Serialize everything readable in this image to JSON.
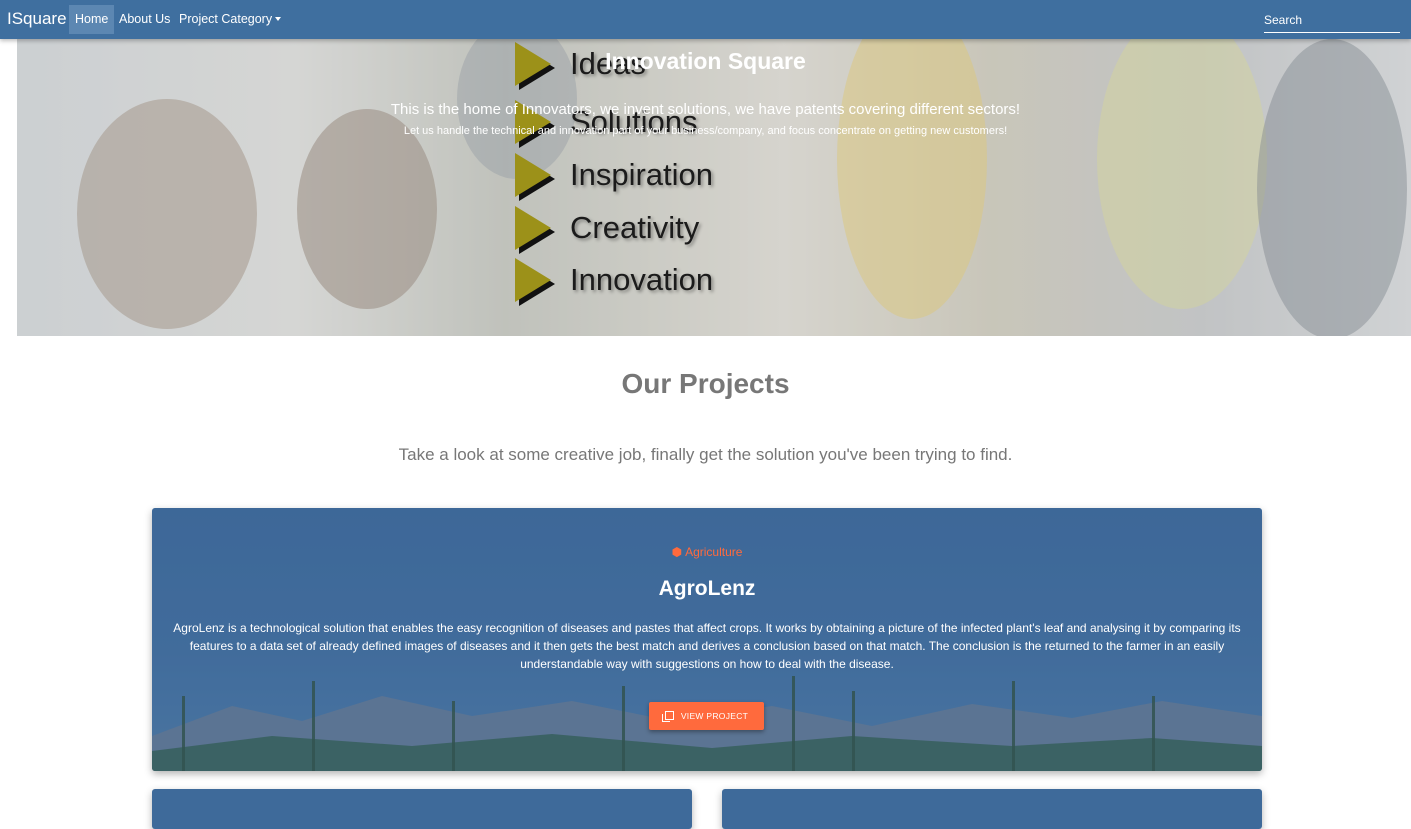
{
  "nav": {
    "brand": "ISquare",
    "items": [
      {
        "label": "Home",
        "active": true
      },
      {
        "label": "About Us",
        "active": false
      },
      {
        "label": "Project Category",
        "dropdown": true
      }
    ],
    "search_placeholder": "Search",
    "bg_color": "#3f6f9f"
  },
  "hero": {
    "title": "Innovation Square",
    "subtitle": "This is the home of Innovators, we invent solutions, we have patents covering different sectors!",
    "tagline": "Let us handle the technical and innovation part of your business/company, and focus concentrate on getting new customers!",
    "image_words": [
      "Ideas",
      "Solutions",
      "Inspiration",
      "Creativity",
      "Innovation"
    ]
  },
  "projects": {
    "title": "Our Projects",
    "subtitle": "Take a look at some creative job, finally get the solution you've been trying to find.",
    "cards": [
      {
        "category": "Agriculture",
        "category_icon": "hexagon-icon",
        "title": "AgroLenz",
        "description": "AgroLenz is a technological solution that enables the easy recognition of diseases and pastes that affect crops. It works by obtaining a picture of the infected plant's leaf and analysing it by comparing its features to a data set of already defined images of diseases and it then gets the best match and derives a conclusion based on that match. The conclusion is the returned to the farmer in an easily understandable way with suggestions on how to deal with the disease.",
        "button_label": "VIEW PROJECT",
        "button_icon": "copy-icon"
      }
    ]
  },
  "colors": {
    "accent": "#ff6a3d",
    "card_blue": "#3e6a9a",
    "heading_gray": "#777777"
  }
}
